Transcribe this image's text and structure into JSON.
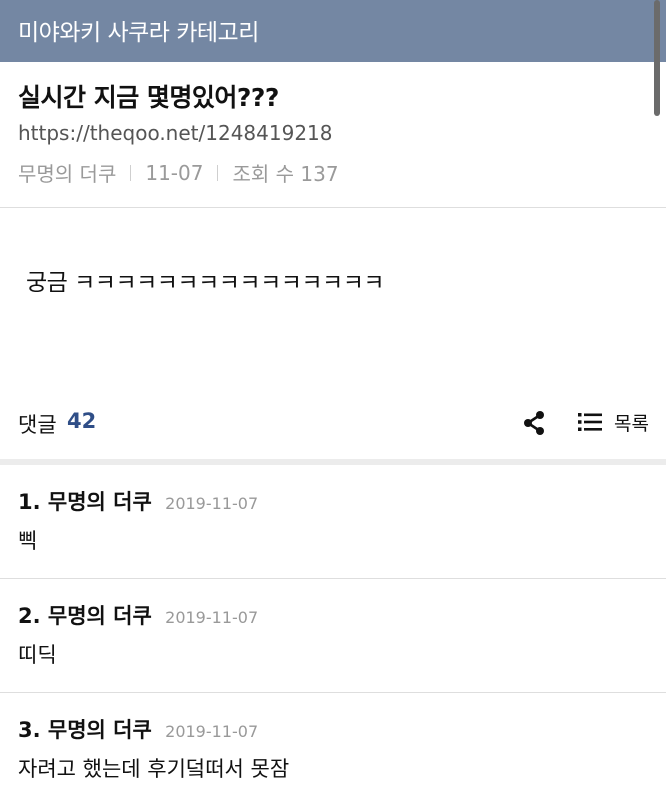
{
  "header": {
    "category": "미야와키 사쿠라 카테고리"
  },
  "post": {
    "title": "실시간 지금 몇명있어???",
    "url": "https://theqoo.net/1248419218",
    "author": "무명의 더쿠",
    "date": "11-07",
    "views": "조회 수 137",
    "content": "궁금 ㅋㅋㅋㅋㅋㅋㅋㅋㅋㅋㅋㅋㅋㅋㅋ"
  },
  "comments_bar": {
    "label": "댓글",
    "count": "42",
    "share_icon": "share-icon",
    "list_icon": "list-icon",
    "list_label": "목록"
  },
  "comments": [
    {
      "number": "1.",
      "author": "무명의 더쿠",
      "date": "2019-11-07",
      "text": "삑"
    },
    {
      "number": "2.",
      "author": "무명의 더쿠",
      "date": "2019-11-07",
      "text": "띠딕"
    },
    {
      "number": "3.",
      "author": "무명의 더쿠",
      "date": "2019-11-07",
      "text": "자려고 했는데 후기덬떠서 못잠"
    }
  ]
}
